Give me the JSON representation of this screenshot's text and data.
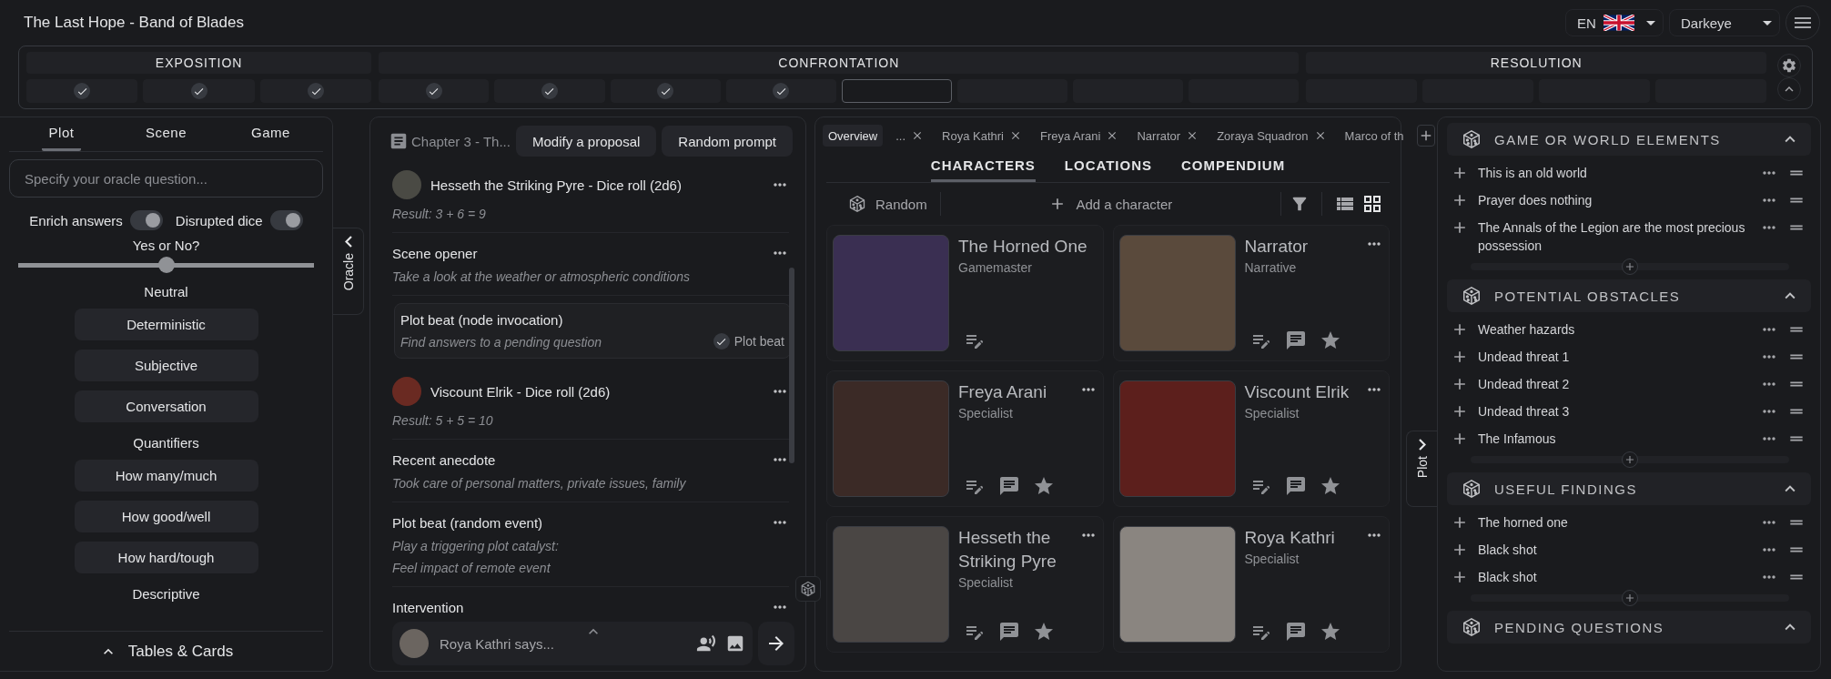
{
  "app": {
    "title": "The Last Hope - Band of Blades",
    "language": "EN",
    "profile": "Darkeye"
  },
  "acts": [
    {
      "title": "EXPOSITION",
      "steps": [
        {
          "checked": true,
          "selected": false
        },
        {
          "checked": true,
          "selected": false
        },
        {
          "checked": true,
          "selected": false
        }
      ]
    },
    {
      "title": "CONFRONTATION",
      "steps": [
        {
          "checked": true,
          "selected": false
        },
        {
          "checked": true,
          "selected": false
        },
        {
          "checked": true,
          "selected": false
        },
        {
          "checked": true,
          "selected": false
        },
        {
          "checked": false,
          "selected": true
        },
        {
          "checked": false,
          "selected": false
        },
        {
          "checked": false,
          "selected": false
        },
        {
          "checked": false,
          "selected": false
        }
      ]
    },
    {
      "title": "RESOLUTION",
      "steps": [
        {
          "checked": false,
          "selected": false
        },
        {
          "checked": false,
          "selected": false
        },
        {
          "checked": false,
          "selected": false
        },
        {
          "checked": false,
          "selected": false
        }
      ]
    }
  ],
  "oracle": {
    "side_tab": "Oracle",
    "tabs": [
      {
        "label": "Plot",
        "selected": true
      },
      {
        "label": "Scene",
        "selected": false
      },
      {
        "label": "Game",
        "selected": false
      }
    ],
    "question": {
      "placeholder": "Specify your oracle question..."
    },
    "toggles": [
      {
        "label": "Enrich answers",
        "on": true
      },
      {
        "label": "Disrupted dice",
        "on": true
      }
    ],
    "slider": {
      "label": "Yes or No?",
      "level": 0.5,
      "reading": "Neutral"
    },
    "groups": [
      {
        "buttons": [
          "Deterministic",
          "Subjective",
          "Conversation"
        ]
      },
      {
        "heading": "Quantifiers",
        "buttons": [
          "How many/much",
          "How good/well",
          "How hard/tough"
        ]
      },
      {
        "heading": "Descriptive"
      }
    ],
    "footer": "Tables & Cards"
  },
  "journal": {
    "chapter": "Chapter 3 - Th...",
    "buttons": [
      "Modify a proposal",
      "Random prompt"
    ],
    "entries": [
      {
        "kind": "roll",
        "title": "Hesseth the Striking Pyre - Dice roll (2d6)",
        "lines": [
          "Result: 3 + 6 = 9"
        ],
        "selected": false
      },
      {
        "kind": "prompt",
        "title": "Scene opener",
        "lines": [
          "Take a look at the weather or atmospheric conditions"
        ],
        "selected": false
      },
      {
        "kind": "prompt",
        "title": "Plot beat (node invocation)",
        "lines": [
          "Find answers to a pending question"
        ],
        "selected": true,
        "tag": {
          "label": "Plot beat",
          "checked": true
        }
      },
      {
        "kind": "roll",
        "title": "Viscount Elrik - Dice roll (2d6)",
        "lines": [
          "Result: 5 + 5 = 10"
        ],
        "selected": false
      },
      {
        "kind": "prompt",
        "title": "Recent anecdote",
        "lines": [
          "Took care of personal matters, private issues, family"
        ],
        "selected": false
      },
      {
        "kind": "prompt",
        "title": "Plot beat (random event)",
        "lines": [
          "Play a triggering plot catalyst:",
          "Feel impact of remote event"
        ],
        "selected": false
      },
      {
        "kind": "prompt",
        "title": "Intervention",
        "selected": false
      }
    ],
    "composer": {
      "placeholder": "Roya Kathri says..."
    }
  },
  "characters": {
    "open_tabs": [
      {
        "label": "Overview",
        "selected": true,
        "closable": false
      },
      {
        "label": "...",
        "selected": false,
        "closable": true
      },
      {
        "label": "Roya Kathri",
        "selected": false,
        "closable": true
      },
      {
        "label": "Freya Arani",
        "selected": false,
        "closable": true
      },
      {
        "label": "Narrator",
        "selected": false,
        "closable": true
      },
      {
        "label": "Zoraya Squadron",
        "selected": false,
        "closable": true
      },
      {
        "label": "Marco of th",
        "selected": false,
        "closable": false
      }
    ],
    "sections": [
      {
        "label": "CHARACTERS",
        "selected": true
      },
      {
        "label": "LOCATIONS",
        "selected": false
      },
      {
        "label": "COMPENDIUM",
        "selected": false
      }
    ],
    "random": "Random",
    "add": "Add a character",
    "views": [
      {
        "kind": "list",
        "selected": false
      },
      {
        "kind": "grid",
        "selected": true
      }
    ],
    "cards": [
      {
        "kind": "gamemaster",
        "name": "The Horned One",
        "role": "Gamemaster"
      },
      {
        "kind": "character",
        "name": "Narrator",
        "role": "Narrative"
      },
      {
        "kind": "character",
        "name": "Freya Arani",
        "role": "Specialist"
      },
      {
        "kind": "character",
        "name": "Viscount Elrik",
        "role": "Specialist"
      },
      {
        "kind": "character",
        "name": "Hesseth the Striking Pyre",
        "role": "Specialist"
      },
      {
        "kind": "character",
        "name": "Roya Kathri",
        "role": "Specialist"
      }
    ]
  },
  "plot": {
    "side_tab": "Plot",
    "sections": [
      {
        "title": "GAME OR WORLD ELEMENTS",
        "expanded": true,
        "items": [
          "This is an old world",
          "Prayer does nothing",
          "The Annals of the Legion are the most precious possession"
        ]
      },
      {
        "title": "POTENTIAL OBSTACLES",
        "expanded": true,
        "items": [
          "Weather hazards",
          "Undead threat 1",
          "Undead threat 2",
          "Undead threat 3",
          "The Infamous"
        ]
      },
      {
        "title": "USEFUL FINDINGS",
        "expanded": true,
        "items": [
          "The horned one",
          "Black shot",
          "Black shot"
        ]
      },
      {
        "title": "PENDING QUESTIONS",
        "expanded": true
      }
    ]
  }
}
